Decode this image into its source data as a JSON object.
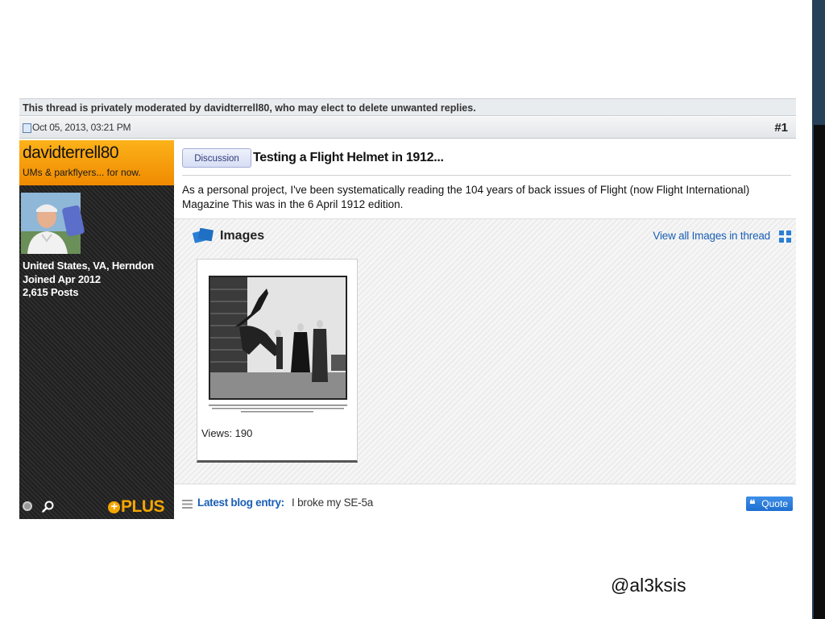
{
  "notice": {
    "moderation": "This thread is privately moderated by davidterrell80, who may elect to delete unwanted replies."
  },
  "post": {
    "date": "Oct 05, 2013, 03:21 PM",
    "number": "#1",
    "prefix": "Discussion",
    "title": "Testing a Flight Helmet in 1912...",
    "body": "As a personal project, I've been systematically reading the 104 years of back issues of Flight (now Flight International) Magazine This was in the 6 April 1912 edition.",
    "attachments": {
      "heading": "Images",
      "view_all_label": "View all Images in thread",
      "items": [
        {
          "views_label": "Views: 190"
        }
      ]
    },
    "footer": {
      "blog_label": "Latest blog entry:",
      "blog_title": "I broke my SE-5a",
      "quote_label": "Quote"
    }
  },
  "user": {
    "name": "davidterrell80",
    "title": "UMs & parkflyers... for now.",
    "location": "United States, VA, Herndon",
    "joined": "Joined Apr 2012",
    "posts": "2,615 Posts",
    "badge": "PLUS"
  },
  "slide": {
    "handle": "@al3ksis"
  },
  "colors": {
    "banner_orange": "#f5a600",
    "link_blue": "#1a5fb4",
    "sidebar_dark": "#262626"
  },
  "icons": {
    "post": "post-icon",
    "images": "images-icon",
    "grid": "grid-icon",
    "search": "search-icon",
    "status": "status-dot-icon",
    "list": "list-icon",
    "quote": "quote-icon"
  }
}
